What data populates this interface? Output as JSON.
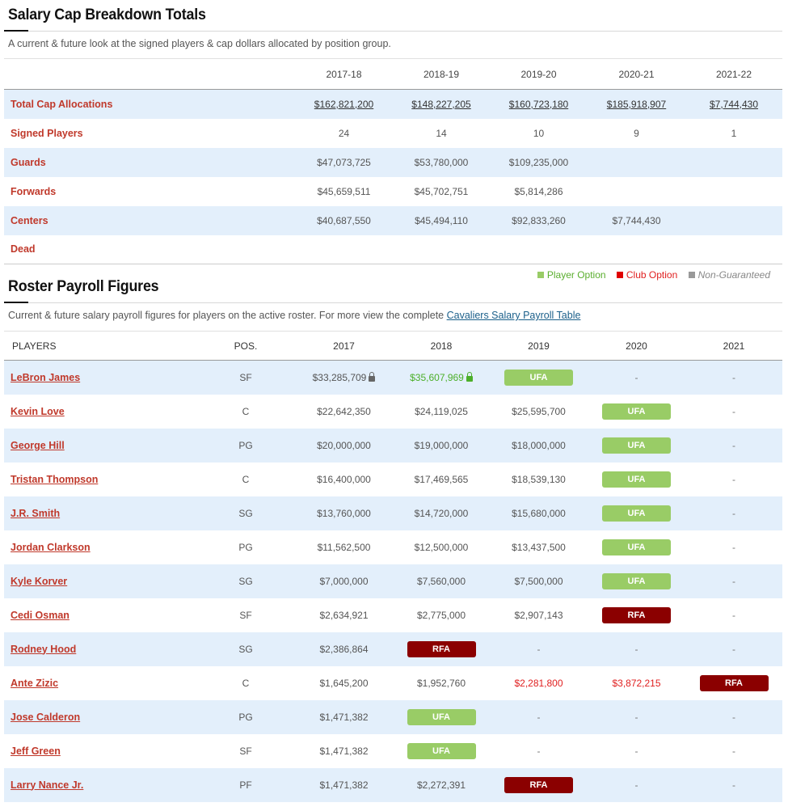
{
  "cap": {
    "title": "Salary Cap Breakdown Totals",
    "description": "A current & future look at the signed players & cap dollars allocated by position group.",
    "columns": [
      "2017-18",
      "2018-19",
      "2019-20",
      "2020-21",
      "2021-22"
    ],
    "rows": [
      {
        "label": "Total Cap Allocations",
        "values": [
          "$162,821,200",
          "$148,227,205",
          "$160,723,180",
          "$185,918,907",
          "$7,744,430"
        ]
      },
      {
        "label": "Signed Players",
        "values": [
          "24",
          "14",
          "10",
          "9",
          "1"
        ]
      },
      {
        "label": "Guards",
        "values": [
          "$47,073,725",
          "$53,780,000",
          "$109,235,000",
          "",
          ""
        ]
      },
      {
        "label": "Forwards",
        "values": [
          "$45,659,511",
          "$45,702,751",
          "$5,814,286",
          "",
          ""
        ]
      },
      {
        "label": "Centers",
        "values": [
          "$40,687,550",
          "$45,494,110",
          "$92,833,260",
          "$7,744,430",
          ""
        ]
      },
      {
        "label": "Dead",
        "values": [
          "",
          "",
          "",
          "",
          ""
        ]
      }
    ]
  },
  "legend": {
    "player_option": "Player Option",
    "club_option": "Club Option",
    "non_guaranteed": "Non-Guaranteed",
    "colors": {
      "player_option": "#99cc66",
      "club_option": "#e00000",
      "non_guaranteed": "#999999"
    }
  },
  "roster": {
    "title": "Roster Payroll Figures",
    "description": "Current & future salary payroll figures for players on the active roster. For more view the complete",
    "link_text": "Cavaliers Salary Payroll Table",
    "headers": [
      "PLAYERS",
      "POS.",
      "2017",
      "2018",
      "2019",
      "2020",
      "2021"
    ],
    "players": [
      {
        "name": "LeBron James",
        "pos": "SF",
        "cells": [
          {
            "v": "$33,285,709",
            "lock": "gray"
          },
          {
            "v": "$35,607,969",
            "lock": "green",
            "style": "green"
          },
          {
            "badge": "UFA"
          },
          {
            "v": "-"
          },
          {
            "v": "-"
          }
        ]
      },
      {
        "name": "Kevin Love",
        "pos": "C",
        "cells": [
          {
            "v": "$22,642,350"
          },
          {
            "v": "$24,119,025"
          },
          {
            "v": "$25,595,700"
          },
          {
            "badge": "UFA"
          },
          {
            "v": "-"
          }
        ]
      },
      {
        "name": "George Hill",
        "pos": "PG",
        "cells": [
          {
            "v": "$20,000,000"
          },
          {
            "v": "$19,000,000"
          },
          {
            "v": "$18,000,000"
          },
          {
            "badge": "UFA"
          },
          {
            "v": "-"
          }
        ]
      },
      {
        "name": "Tristan Thompson",
        "pos": "C",
        "cells": [
          {
            "v": "$16,400,000"
          },
          {
            "v": "$17,469,565"
          },
          {
            "v": "$18,539,130"
          },
          {
            "badge": "UFA"
          },
          {
            "v": "-"
          }
        ]
      },
      {
        "name": "J.R. Smith",
        "pos": "SG",
        "cells": [
          {
            "v": "$13,760,000"
          },
          {
            "v": "$14,720,000"
          },
          {
            "v": "$15,680,000"
          },
          {
            "badge": "UFA"
          },
          {
            "v": "-"
          }
        ]
      },
      {
        "name": "Jordan Clarkson",
        "pos": "PG",
        "cells": [
          {
            "v": "$11,562,500"
          },
          {
            "v": "$12,500,000"
          },
          {
            "v": "$13,437,500"
          },
          {
            "badge": "UFA"
          },
          {
            "v": "-"
          }
        ]
      },
      {
        "name": "Kyle Korver",
        "pos": "SG",
        "cells": [
          {
            "v": "$7,000,000"
          },
          {
            "v": "$7,560,000"
          },
          {
            "v": "$7,500,000"
          },
          {
            "badge": "UFA"
          },
          {
            "v": "-"
          }
        ]
      },
      {
        "name": "Cedi Osman",
        "pos": "SF",
        "cells": [
          {
            "v": "$2,634,921"
          },
          {
            "v": "$2,775,000"
          },
          {
            "v": "$2,907,143"
          },
          {
            "badge": "RFA"
          },
          {
            "v": "-"
          }
        ]
      },
      {
        "name": "Rodney Hood",
        "pos": "SG",
        "cells": [
          {
            "v": "$2,386,864"
          },
          {
            "badge": "RFA"
          },
          {
            "v": "-"
          },
          {
            "v": "-"
          },
          {
            "v": "-"
          }
        ]
      },
      {
        "name": "Ante Zizic",
        "pos": "C",
        "cells": [
          {
            "v": "$1,645,200"
          },
          {
            "v": "$1,952,760"
          },
          {
            "v": "$2,281,800",
            "style": "red"
          },
          {
            "v": "$3,872,215",
            "style": "red"
          },
          {
            "badge": "RFA"
          }
        ]
      },
      {
        "name": "Jose Calderon",
        "pos": "PG",
        "cells": [
          {
            "v": "$1,471,382"
          },
          {
            "badge": "UFA"
          },
          {
            "v": "-"
          },
          {
            "v": "-"
          },
          {
            "v": "-"
          }
        ]
      },
      {
        "name": "Jeff Green",
        "pos": "SF",
        "cells": [
          {
            "v": "$1,471,382"
          },
          {
            "badge": "UFA"
          },
          {
            "v": "-"
          },
          {
            "v": "-"
          },
          {
            "v": "-"
          }
        ]
      },
      {
        "name": "Larry Nance Jr.",
        "pos": "PF",
        "cells": [
          {
            "v": "$1,471,382"
          },
          {
            "v": "$2,272,391"
          },
          {
            "badge": "RFA"
          },
          {
            "v": "-"
          },
          {
            "v": "-"
          }
        ]
      }
    ]
  }
}
